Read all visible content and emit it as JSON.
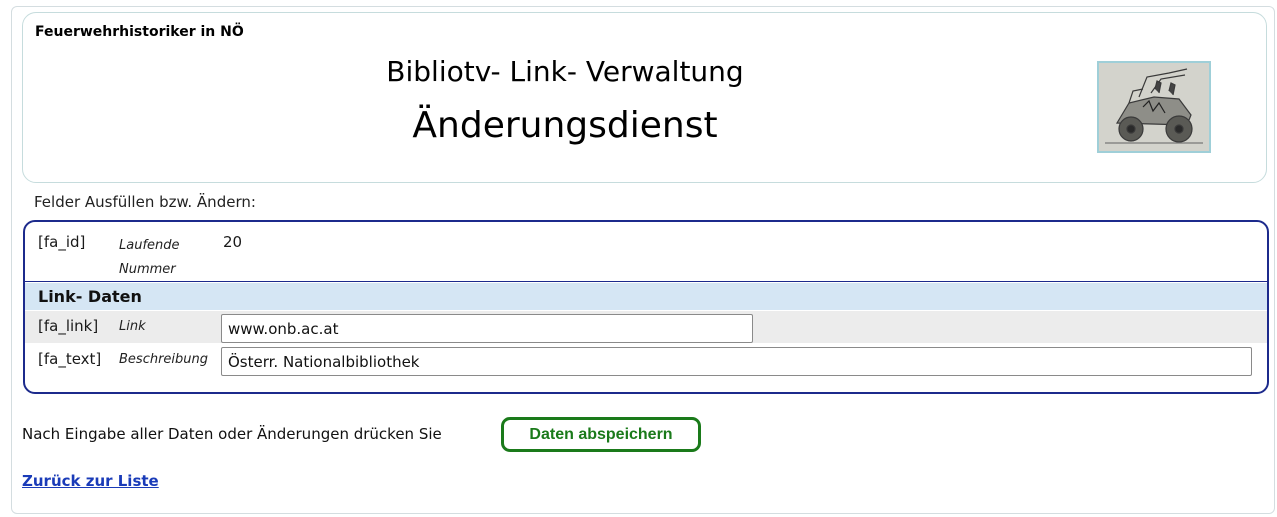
{
  "header": {
    "org_name": "Feuerwehrhistoriker in NÖ",
    "title": "Bibliotv- Link- Verwaltung",
    "subtitle": "Änderungsdienst",
    "logo_icon": "fire-engine-sketch-icon"
  },
  "intro": "Felder Ausfüllen bzw. Ändern:",
  "form": {
    "id_row": {
      "field": "[fa_id]",
      "description": "Laufende Nummer",
      "value": "20"
    },
    "section_title": "Link- Daten",
    "link_row": {
      "field": "[fa_link]",
      "description": "Link",
      "value": "www.onb.ac.at"
    },
    "text_row": {
      "field": "[fa_text]",
      "description": "Beschreibung",
      "value": "Österr. Nationalbibliothek"
    }
  },
  "footer": {
    "instruction": "Nach Eingabe aller Daten oder Änderungen drücken Sie",
    "save_label": "Daten abspeichern",
    "back_label": "Zurück zur Liste"
  },
  "colors": {
    "form_border": "#1c2a8c",
    "section_bg": "#d5e6f4",
    "save_green": "#1a7a1a",
    "link_blue": "#1a3bb8"
  }
}
